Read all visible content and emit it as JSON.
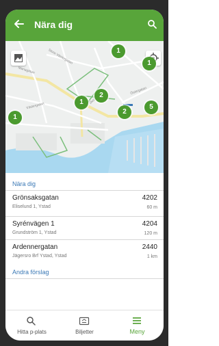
{
  "appbar": {
    "title": "Nära dig",
    "back_icon": "arrow-left-icon",
    "search_icon": "search-icon",
    "color": "#58a53a"
  },
  "map": {
    "layers_icon": "image-icon",
    "locate_icon": "my-location-icon",
    "markers": [
      "1",
      "1",
      "2",
      "1",
      "2",
      "5",
      "1"
    ],
    "streets": [
      "Stora Västergatan",
      "Mariagatan",
      "Västergatan",
      "Skottegatan",
      "Östergatan"
    ]
  },
  "nearby": {
    "header": "Nära dig",
    "items": [
      {
        "name": "Grönsaksgatan",
        "address": "Eliselund 1, Ystad",
        "code": "4202",
        "distance": "60 m"
      },
      {
        "name": "Syrénvägen 1",
        "address": "Grundström 1, Ystad",
        "code": "4204",
        "distance": "120 m"
      },
      {
        "name": "Ardennergatan",
        "address": "Jägersro Brf Ystad, Ystad",
        "code": "2440",
        "distance": "1 km"
      }
    ]
  },
  "suggestions": {
    "header": "Andra förslag"
  },
  "bottomnav": {
    "items": [
      {
        "label": "Hitta p-plats",
        "icon": "search-icon"
      },
      {
        "label": "Biljetter",
        "icon": "ticket-icon"
      },
      {
        "label": "Meny",
        "icon": "menu-icon"
      }
    ],
    "active_color": "#58a53a"
  }
}
